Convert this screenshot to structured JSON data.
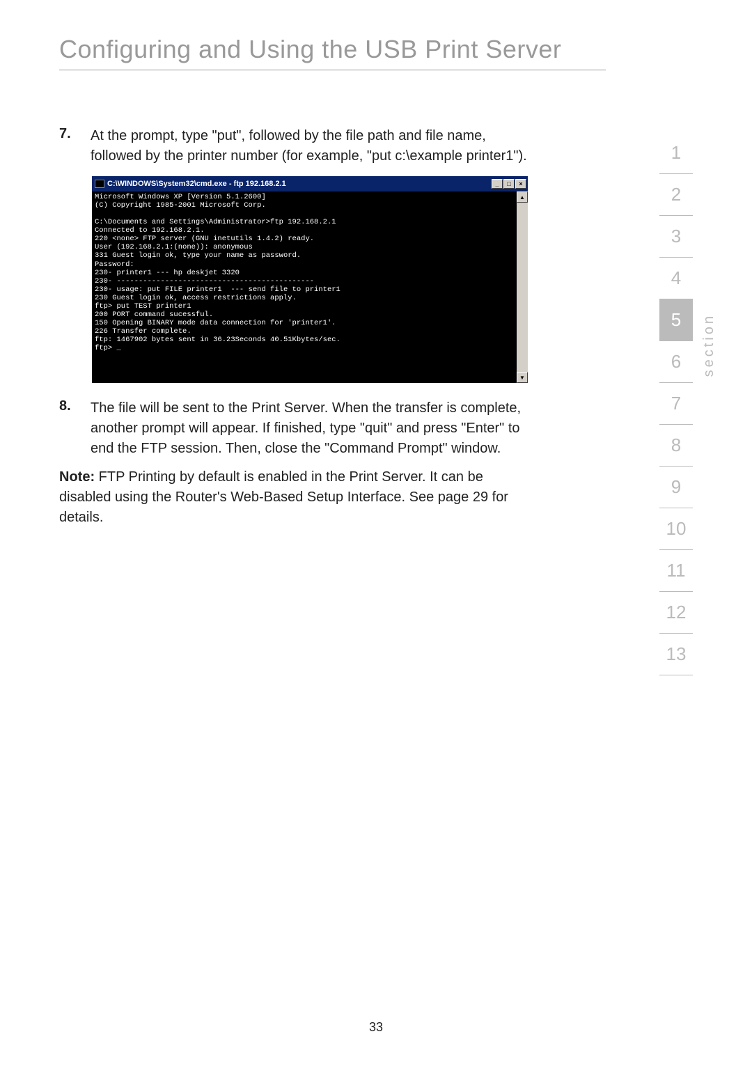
{
  "title": "Configuring and Using the USB Print Server",
  "steps": [
    {
      "num": "7.",
      "text": "At the prompt, type \"put\", followed by the file path and file name, followed by the printer number (for example, \"put c:\\example printer1\")."
    },
    {
      "num": "8.",
      "text": "The file will be sent to the Print Server. When the transfer is complete, another prompt will appear. If finished, type \"quit\" and press \"Enter\" to end the FTP session. Then, close the \"Command Prompt\" window."
    }
  ],
  "cmd": {
    "title": "C:\\WINDOWS\\System32\\cmd.exe - ftp 192.168.2.1",
    "min": "_",
    "max": "□",
    "close": "×",
    "body": "Microsoft Windows XP [Version 5.1.2600]\n(C) Copyright 1985-2001 Microsoft Corp.\n\nC:\\Documents and Settings\\Administrator>ftp 192.168.2.1\nConnected to 192.168.2.1.\n220 <none> FTP server (GNU inetutils 1.4.2) ready.\nUser (192.168.2.1:(none)): anonymous\n331 Guest login ok, type your name as password.\nPassword:\n230- printer1 --- hp deskjet 3320\n230- ---------------------------------------------\n230- usage: put FILE printer1  --- send file to printer1\n230 Guest login ok, access restrictions apply.\nftp> put TEST printer1\n200 PORT command sucessful.\n150 Opening BINARY mode data connection for 'printer1'.\n226 Transfer complete.\nftp: 1467902 bytes sent in 36.23Seconds 40.51Kbytes/sec.\nftp> _"
  },
  "note_label": "Note:",
  "note_text": " FTP Printing by default is enabled in the Print Server. It can be disabled using the Router's Web-Based Setup Interface. See page 29 for details.",
  "section_label": "section",
  "sections": [
    "1",
    "2",
    "3",
    "4",
    "5",
    "6",
    "7",
    "8",
    "9",
    "10",
    "11",
    "12",
    "13"
  ],
  "active_section": "5",
  "page_number": "33"
}
